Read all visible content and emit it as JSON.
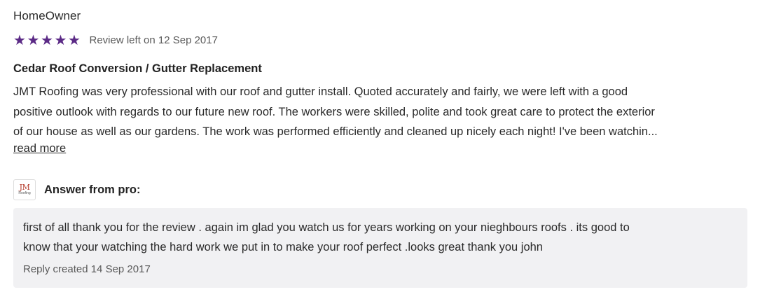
{
  "review": {
    "reviewer_name": "HomeOwner",
    "rating": 5,
    "rating_max": 5,
    "star_color": "#5b2a86",
    "stars": [
      "★",
      "★",
      "★",
      "★",
      "★"
    ],
    "date_label": "Review left on 12 Sep 2017",
    "title": "Cedar Roof Conversion / Gutter Replacement",
    "body_lines": [
      "JMT Roofing was very professional with our roof and gutter install. Quoted accurately and fairly, we were left with a good",
      "positive outlook with regards to our future new roof. The workers were skilled, polite and took great care to protect the exterior",
      "of our house as well as our gardens. The work was performed efficiently and cleaned up nicely each night! I've been watchin..."
    ],
    "read_more_label": "read more"
  },
  "pro_answer": {
    "logo_text": "JM",
    "logo_subtext": "Roofing",
    "heading": "Answer from pro:",
    "reply_lines": [
      "first of all thank you for the review . again im glad you watch us for years working on your nieghbours roofs . its good to",
      "know that your watching the hard work we put in to make your roof perfect .looks great thank you john"
    ],
    "reply_date_label": "Reply created 14 Sep 2017"
  }
}
